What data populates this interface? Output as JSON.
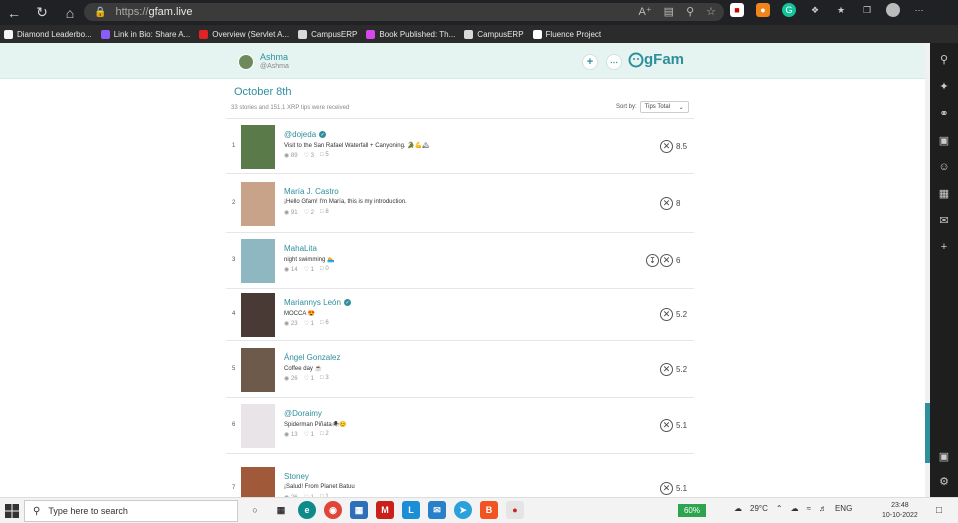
{
  "browser": {
    "url_protocol": "https://",
    "url_host": "gfam.live",
    "bookmarks": [
      {
        "label": "Diamond Leaderbo...",
        "color": "#f5f5f5"
      },
      {
        "label": "Link in Bio: Share A...",
        "color": "#8b5cf6"
      },
      {
        "label": "Overview (Servlet A...",
        "color": "#e02424"
      },
      {
        "label": "CampusERP",
        "color": "#d9d9d9"
      },
      {
        "label": "Book Published: Th...",
        "color": "#d946ef"
      },
      {
        "label": "CampusERP",
        "color": "#d9d9d9"
      },
      {
        "label": "Fluence Project",
        "color": "#ffffff"
      }
    ]
  },
  "header": {
    "name": "Ashma",
    "handle": "@Ashma",
    "logo_text": "gFam"
  },
  "feed": {
    "date": "October 8th",
    "summary": "33 stories and 151.1 XRP tips were received",
    "sort_label": "Sort by:",
    "sort_value": "Tips Total"
  },
  "stories": [
    {
      "rank": "1",
      "name": "@dojeda",
      "verified": true,
      "text": "Visit to the San Rafael Waterfall + Canyoning. 🐊💪🏔",
      "views": "89",
      "likes": "3",
      "comments": "5",
      "tip": "8.5",
      "download": false,
      "thumb": "#5b7a4a"
    },
    {
      "rank": "2",
      "name": "María J. Castro",
      "verified": false,
      "text": "¡Hello Gfam! I'm María, this is my introduction.",
      "views": "91",
      "likes": "2",
      "comments": "8",
      "tip": "8",
      "download": false,
      "thumb": "#c9a389"
    },
    {
      "rank": "3",
      "name": "MahaLita",
      "verified": false,
      "text": "night swimming 🏊",
      "views": "14",
      "likes": "1",
      "comments": "0",
      "tip": "6",
      "download": true,
      "thumb": "#8fb7c2"
    },
    {
      "rank": "4",
      "name": "Mariannys León",
      "verified": true,
      "text": "MOCCA 😍",
      "views": "23",
      "likes": "1",
      "comments": "6",
      "tip": "5.2",
      "download": false,
      "thumb": "#4a3a35"
    },
    {
      "rank": "5",
      "name": "Ángel Gonzalez",
      "verified": false,
      "text": "Coffee day ☕",
      "views": "26",
      "likes": "1",
      "comments": "3",
      "tip": "5.2",
      "download": false,
      "thumb": "#6d5a4a"
    },
    {
      "rank": "6",
      "name": "@Doraimy",
      "verified": false,
      "text": "Spiderman Piñata🕷😊",
      "views": "13",
      "likes": "1",
      "comments": "2",
      "tip": "5.1",
      "download": false,
      "thumb": "#e8e4e8"
    },
    {
      "rank": "7",
      "name": "Stoney",
      "verified": false,
      "text": "¡Salud! From Planet Batuu",
      "views": "26",
      "likes": "1",
      "comments": "1",
      "tip": "5.1",
      "download": false,
      "thumb": "#a05a3a"
    }
  ],
  "taskbar": {
    "search_placeholder": "Type here to search",
    "battery": "60%",
    "weather": "29°C",
    "lang": "ENG",
    "time": "23:48",
    "date": "10-10-2022"
  }
}
